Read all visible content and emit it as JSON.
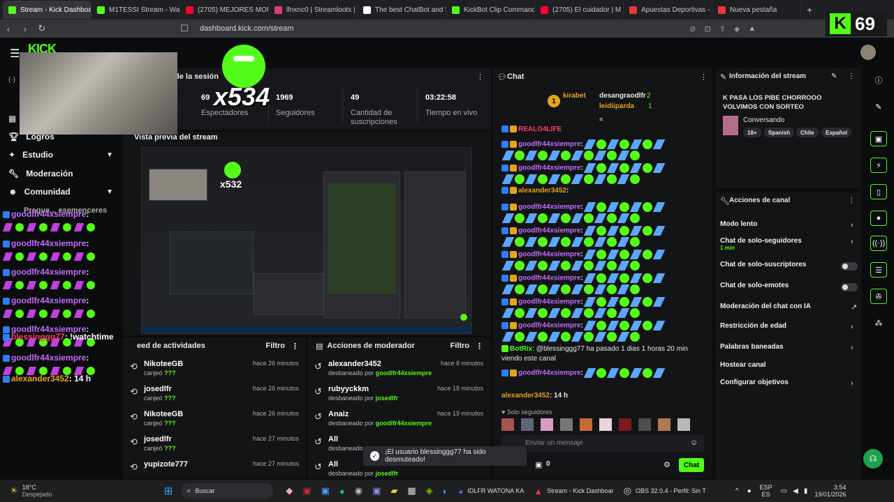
{
  "browser": {
    "tabs": [
      {
        "title": "Stream - Kick Dashboa",
        "color": "#53fc18"
      },
      {
        "title": "M1TESSI Stream - Wat",
        "color": "#53fc18"
      },
      {
        "title": "(2705) MEJORES MOMENT",
        "color": "#ff0033"
      },
      {
        "title": "lfnxnc0 | Streamloots | Inte",
        "color": "#e23a7a"
      },
      {
        "title": "The best ChatBot and Wid",
        "color": "#ffffff"
      },
      {
        "title": "KickBot Clip Command",
        "color": "#53fc18"
      },
      {
        "title": "(2705) El cuidador | M",
        "color": "#ff0033"
      },
      {
        "title": "Apuestas Deportivas - Apu",
        "color": "#e53935"
      },
      {
        "title": "Nueva pestaña",
        "color": "#e53935"
      }
    ],
    "url": "dashboard.kick.com/stream",
    "new_tab": "+"
  },
  "overlay": {
    "counter": "x534",
    "preview_counter": "x532",
    "kick_viewers": "69",
    "kick_letter": "K"
  },
  "sidebar": {
    "items": [
      {
        "label": "Logros",
        "icon": "trophy-icon",
        "chevron": false
      },
      {
        "label": "Estudio",
        "icon": "sparkle-icon",
        "chevron": true
      },
      {
        "label": "Moderación",
        "icon": "wrench-icon",
        "chevron": false
      },
      {
        "label": "Comunidad",
        "icon": "users-icon",
        "chevron": true
      }
    ],
    "partial": "Preque... esemenceres"
  },
  "session": {
    "title": "de la sesión",
    "stats": [
      {
        "value": "69",
        "label": "Espectadores"
      },
      {
        "value": "1969",
        "label": "Seguidores"
      },
      {
        "value": "49",
        "label": "Cantidad de suscripciones"
      },
      {
        "value": "03:22:58",
        "label": "Tiempo en vivo"
      }
    ]
  },
  "preview": {
    "title": "Vista previa del stream"
  },
  "overlay_chat": [
    {
      "user": "goodlfr44xsiempre",
      "text": ":",
      "color": "#c26cff"
    },
    {
      "user": "goodlfr44xsiempre",
      "text": ":",
      "color": "#c26cff"
    },
    {
      "user": "goodlfr44xsiempre",
      "text": ":",
      "color": "#c26cff"
    },
    {
      "user": "goodlfr44xsiempre",
      "text": ":",
      "color": "#c26cff"
    },
    {
      "user": "goodlfr44xsiempre",
      "text": ":",
      "color": "#c26cff"
    },
    {
      "user": "blessinggg77",
      "text": ": !watchtime",
      "color": "#ff3b6b"
    },
    {
      "user": "goodlfr44xsiempre",
      "text": ":",
      "color": "#c26cff"
    },
    {
      "user": "alexander3452",
      "text": ": 14 h",
      "color": "#e5a41c"
    }
  ],
  "activity": {
    "title": "eed de actividades",
    "filter": "Filtro",
    "rows": [
      {
        "name": "NikoteeGB",
        "action": "canjeó",
        "target": "???",
        "time": "hace 26 minutos"
      },
      {
        "name": "josedlfr",
        "action": "canjeó",
        "target": "???",
        "time": "hace 26 minutos"
      },
      {
        "name": "NikoteeGB",
        "action": "canjeó",
        "target": "???",
        "time": "hace 26 minutos"
      },
      {
        "name": "josedlfr",
        "action": "canjeó",
        "target": "???",
        "time": "hace 27 minutos"
      },
      {
        "name": "yupizote777",
        "action": "",
        "target": "",
        "time": "hace 27 minutos"
      }
    ]
  },
  "modactions": {
    "title": "Acciones de moderador",
    "filter": "Filtro",
    "rows": [
      {
        "name": "alexander3452",
        "action": "desbaneado por",
        "target": "goodlfr44xsiempre",
        "time": "hace 8 minutos"
      },
      {
        "name": "rubyyckkm",
        "action": "desbaneado por",
        "target": "josedlfr",
        "time": "hace 18 minutos"
      },
      {
        "name": "Anaiz",
        "action": "desbaneado por",
        "target": "goodlfr44xsiempre",
        "time": "hace 19 minutos"
      },
      {
        "name": "All",
        "action": "desbaneado",
        "target": "",
        "time": ""
      },
      {
        "name": "All",
        "action": "desbaneado por",
        "target": "josedlfr",
        "time": ""
      }
    ]
  },
  "chat": {
    "title": "Chat",
    "top": {
      "rank": "1",
      "user1": "kirabet",
      "user2": "desangraodlfr",
      "count2": "2",
      "user3": "leidiiparda",
      "count3": "1"
    },
    "messages": [
      {
        "user": "REALG4LIFE",
        "text": "",
        "color": "#ff3b6b"
      },
      {
        "user": "goodlfr44xsiempre",
        "text": ":",
        "color": "#c26cff"
      },
      {
        "user": "goodlfr44xsiempre",
        "text": ":",
        "color": "#c26cff"
      },
      {
        "user": "alexander3452",
        "text": ":",
        "color": "#e5a41c"
      },
      {
        "user": "goodlfr44xsiempre",
        "text": ":",
        "color": "#c26cff"
      },
      {
        "user": "goodlfr44xsiempre",
        "text": ":",
        "color": "#c26cff"
      },
      {
        "user": "goodlfr44xsiempre",
        "text": ":",
        "color": "#c26cff"
      },
      {
        "user": "goodlfr44xsiempre",
        "text": ":",
        "color": "#c26cff"
      },
      {
        "user": "goodlfr44xsiempre",
        "text": ":",
        "color": "#c26cff"
      },
      {
        "user": "goodlfr44xsiempre",
        "text": ":",
        "color": "#c26cff"
      }
    ],
    "botrix_user": "BotRix",
    "botrix_text": ": @blessinggg77 ha pasado 1 dias 1 horas 20 min viendo este canal",
    "last_user": "alexander3452",
    "last_text": ": 14 h",
    "followers_only": "Solo seguidores",
    "input_placeholder": "Enviar un mensaje",
    "points": "0",
    "send_label": "Chat"
  },
  "toast": "¡El usuario blessinggg77 ha sido desmuteado!",
  "stream_info": {
    "title": "Información del stream",
    "stream_title": "K PASA LOS PIBE CHORROOO VOLVIMOS CON SORTEO",
    "category": "Conversando",
    "tags": [
      "18+",
      "Spanish",
      "Chile",
      "Español"
    ]
  },
  "channel_actions": {
    "title": "Acciones de canal",
    "rows": [
      {
        "label": "Modo lento",
        "sub": "",
        "control": "chevron"
      },
      {
        "label": "Chat de solo-seguidores",
        "sub": "1 min",
        "control": "chevron"
      },
      {
        "label": "Chat de solo-suscriptores",
        "sub": "",
        "control": "toggle"
      },
      {
        "label": "Chat de solo-emotes",
        "sub": "",
        "control": "toggle"
      },
      {
        "label": "Moderación del chat con IA",
        "sub": "",
        "control": "external"
      },
      {
        "label": "Restricción de edad",
        "sub": "",
        "control": "chevron"
      },
      {
        "label": "Palabras baneadas",
        "sub": "",
        "control": "chevron"
      },
      {
        "label": "Hostear canal",
        "sub": "",
        "control": ""
      },
      {
        "label": "Configurar objetivos",
        "sub": "",
        "control": "chevron"
      }
    ]
  },
  "taskbar": {
    "weather_temp": "18°C",
    "weather_text": "Despejado",
    "search": "Buscar",
    "apps": [
      {
        "label": "IDLFR WATONA KA"
      },
      {
        "label": "Stream - Kick Dashboar"
      },
      {
        "label": "OBS 32.0.4 - Perfil: Sin T"
      }
    ],
    "lang1": "ESP",
    "lang2": "ES",
    "time": "3:54",
    "date": "19/01/2026"
  },
  "colors": {
    "accent": "#53fc18",
    "panel": "#131416",
    "bg": "#0b0c0d"
  }
}
